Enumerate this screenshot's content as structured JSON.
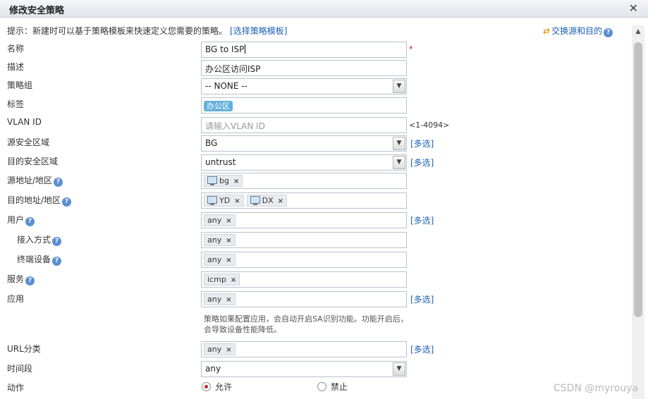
{
  "window": {
    "title": "修改安全策略",
    "close_icon": "close-icon"
  },
  "hint": {
    "text": "提示：新建时可以基于策略模板来快速定义您需要的策略。",
    "link": "[选择策略模板]"
  },
  "swap": {
    "icon": "swap-arrows-icon",
    "label": "交换源和目的"
  },
  "help_glyph": "?",
  "fields": {
    "name": {
      "label": "名称",
      "value": "BG to ISP",
      "required_mark": "*"
    },
    "description": {
      "label": "描述",
      "value": "办公区访问ISP"
    },
    "policy_group": {
      "label": "策略组",
      "value": "-- NONE --"
    },
    "tag": {
      "label": "标签",
      "value": "办公区"
    },
    "vlan": {
      "label": "VLAN ID",
      "placeholder": "请输入VLAN ID",
      "range": "<1-4094>"
    },
    "src_zone": {
      "label": "源安全区域",
      "value": "BG",
      "multi": "[多选]"
    },
    "dst_zone": {
      "label": "目的安全区域",
      "value": "untrust",
      "multi": "[多选]"
    },
    "src_addr": {
      "label": "源地址/地区",
      "tags": [
        "bg"
      ]
    },
    "dst_addr": {
      "label": "目的地址/地区",
      "tags": [
        "YD",
        "DX"
      ]
    },
    "user": {
      "label": "用户",
      "tag": "any",
      "multi": "[多选]"
    },
    "access_mode": {
      "label": "接入方式",
      "tag": "any"
    },
    "terminal": {
      "label": "终端设备",
      "tag": "any"
    },
    "service": {
      "label": "服务",
      "tag": "icmp"
    },
    "application": {
      "label": "应用",
      "tag": "any",
      "multi": "[多选]",
      "note": "策略如果配置应用，会自动开启SA识别功能。功能开启后，会导致设备性能降低。"
    },
    "url": {
      "label": "URL分类",
      "tag": "any",
      "multi": "[多选]"
    },
    "schedule": {
      "label": "时间段",
      "value": "any"
    },
    "action": {
      "label": "动作",
      "options": [
        "允许",
        "禁止"
      ],
      "selected": "允许"
    }
  },
  "tag_remove_glyph": "×",
  "dropdown_glyph": "▼",
  "scroll_up_glyph": "▲",
  "watermark": "CSDN @myrouya",
  "colors": {
    "link": "#1a5fb4",
    "tag_pill": "#62b0da",
    "radio_on": "#c0282d",
    "required": "#dd0000"
  }
}
